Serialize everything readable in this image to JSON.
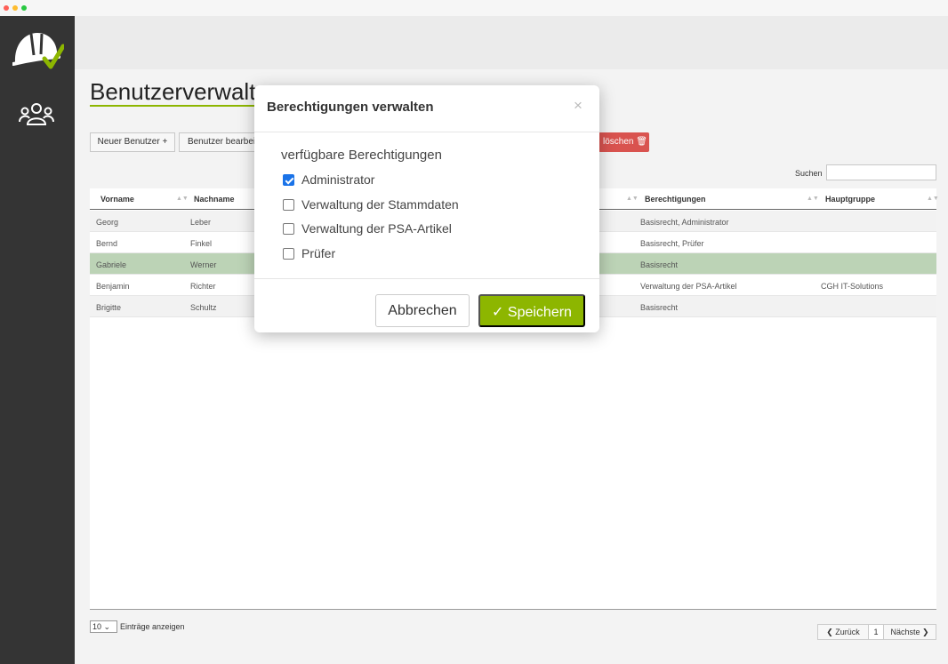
{
  "page": {
    "title": "Benutzerverwaltung",
    "new_button": "Neuer Benutzer +",
    "edit_button": "Benutzer bearbeiten",
    "delete_button": "löschen 🗑",
    "search_label": "Suchen",
    "search_value": ""
  },
  "colors": {
    "accent": "#8db600",
    "sidebar": "#343434",
    "danger": "#d9534f",
    "selected_row": "#bcd3b6",
    "checkbox": "#1a73e8"
  },
  "table": {
    "headers": {
      "vorname": "Vorname",
      "nachname": "Nachname",
      "berechtigungen": "Berechtigungen",
      "hauptgruppe": "Hauptgruppe"
    },
    "rows": [
      {
        "vorname": "Georg",
        "nachname": "Leber",
        "berechtigungen": "Basisrecht, Administrator",
        "hauptgruppe": ""
      },
      {
        "vorname": "Bernd",
        "nachname": "Finkel",
        "berechtigungen": "Basisrecht, Prüfer",
        "hauptgruppe": ""
      },
      {
        "vorname": "Gabriele",
        "nachname": "Werner",
        "berechtigungen": "Basisrecht",
        "hauptgruppe": ""
      },
      {
        "vorname": "Benjamin",
        "nachname": "Richter",
        "berechtigungen": "Verwaltung der PSA-Artikel",
        "hauptgruppe": "CGH IT-Solutions"
      },
      {
        "vorname": "Brigitte",
        "nachname": "Schultz",
        "berechtigungen": "Basisrecht",
        "hauptgruppe": ""
      }
    ],
    "selected_row": 2
  },
  "footer": {
    "page_length": "10",
    "page_length_label": "Einträge anzeigen",
    "prev": "❮ Zurück",
    "current_page": "1",
    "next": "Nächste ❯"
  },
  "modal": {
    "title": "Berechtigungen verwalten",
    "close": "×",
    "heading": "verfügbare Berechtigungen",
    "permissions": [
      {
        "label": "Administrator",
        "checked": true
      },
      {
        "label": "Verwaltung der Stammdaten",
        "checked": false
      },
      {
        "label": "Verwaltung der PSA-Artikel",
        "checked": false
      },
      {
        "label": "Prüfer",
        "checked": false
      }
    ],
    "cancel": "Abbrechen",
    "save": "✓ Speichern"
  },
  "icons": {
    "logo": "helmet-check-icon",
    "users": "users-icon"
  }
}
